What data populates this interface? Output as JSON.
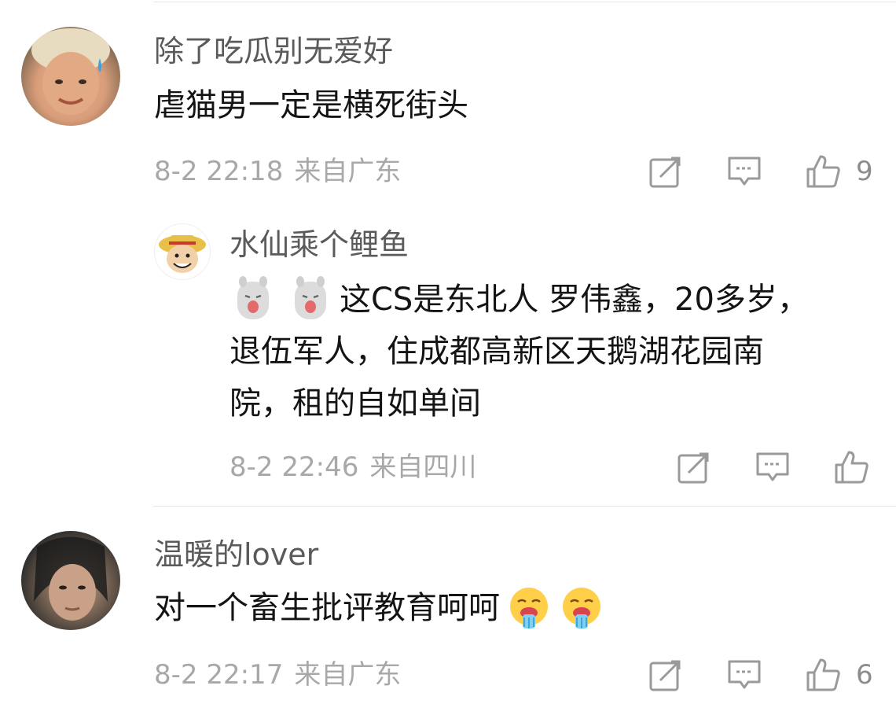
{
  "comments": [
    {
      "user": "除了吃瓜别无爱好",
      "text": "虐猫男一定是横死街头",
      "date": "8-2 22:18",
      "location": "来自广东",
      "likes": "9",
      "icons": [
        "share-icon",
        "comment-icon",
        "like-icon"
      ]
    },
    {
      "user": "水仙乘个鲤鱼",
      "text_lines": [
        "这CS是东北人 罗伟鑫，20多岁，",
        "退伍军人，住成都高新区天鹅湖花园南",
        "院，租的自如单间"
      ],
      "emojis": [
        "alpaca-emoji",
        "alpaca-emoji"
      ],
      "date": "8-2 22:46",
      "location": "来自四川",
      "icons": [
        "share-icon",
        "comment-icon",
        "like-icon"
      ]
    },
    {
      "user": "温暖的lover",
      "text": "对一个畜生批评教育呵呵",
      "emojis": [
        "drooling-face-emoji",
        "drooling-face-emoji"
      ],
      "date": "8-2 22:17",
      "location": "来自广东",
      "likes": "6",
      "icons": [
        "share-icon",
        "comment-icon",
        "like-icon"
      ]
    }
  ]
}
